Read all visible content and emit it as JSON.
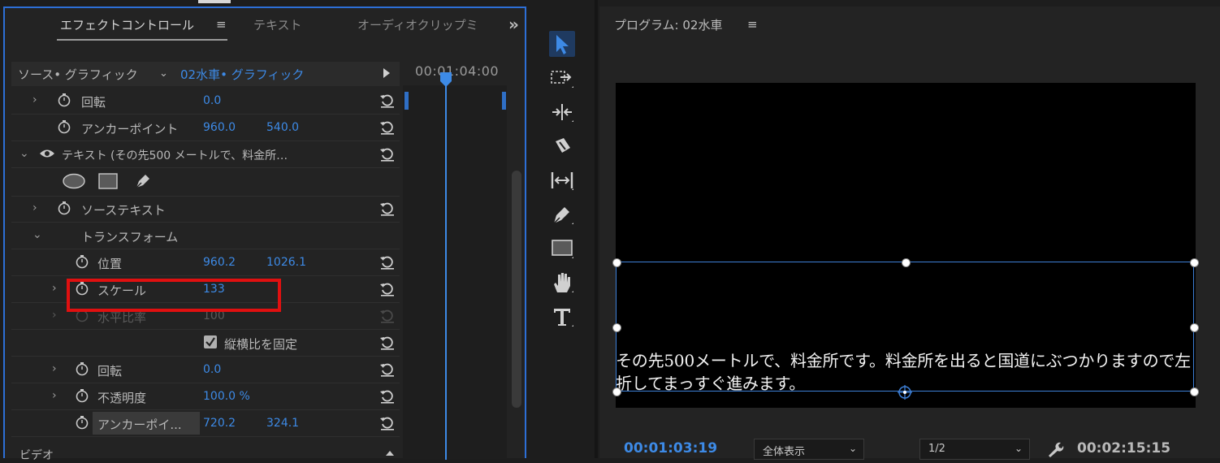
{
  "effect_controls": {
    "tabs": [
      {
        "label": "エフェクトコントロール"
      },
      {
        "label": "テキスト"
      },
      {
        "label": "オーディオクリップミ"
      }
    ],
    "menu_glyph": "≡",
    "overflow_glyph": "»",
    "source_label": "ソース• グラフィック",
    "clip_label": "02水車• グラフィック",
    "time_ruler": "00:01:04:00",
    "rows": {
      "rotation_top": {
        "label": "回転",
        "v1": "0.0"
      },
      "anchor_top": {
        "label": "アンカーポイント",
        "v1": "960.0",
        "v2": "540.0"
      },
      "text_layer": {
        "label": "テキスト (その先500 メートルで、料金所…"
      },
      "source_text": {
        "label": "ソーステキスト"
      },
      "transform": {
        "label": "トランスフォーム"
      },
      "position": {
        "label": "位置",
        "v1": "960.2",
        "v2": "1026.1"
      },
      "scale": {
        "label": "スケール",
        "v1": "133"
      },
      "scale_width": {
        "label": "水平比率",
        "v1": "100"
      },
      "uniform": {
        "label": "縦横比を固定",
        "checked": true
      },
      "rotation": {
        "label": "回転",
        "v1": "0.0"
      },
      "opacity": {
        "label": "不透明度",
        "v1": "100.0 %"
      },
      "anchor": {
        "label": "アンカーポイ...",
        "v1": "720.2",
        "v2": "324.1"
      }
    },
    "video_section": "ビデオ"
  },
  "program": {
    "title": "プログラム: 02水車",
    "menu_glyph": "≡",
    "caption": "その先500メートルで、料金所です。料金所を出ると国道にぶつかりますので左折してまっすぐ進みます。",
    "timecode": "00:01:03:19",
    "fit_label": "全体表示",
    "resolution_label": "1/2",
    "duration": "00:02:15:15"
  },
  "colors": {
    "accent": "#3d8ae6",
    "highlight": "#e01010",
    "panel_border": "#2d6fd6"
  }
}
